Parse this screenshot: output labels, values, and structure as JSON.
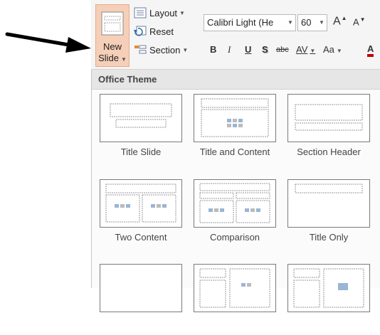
{
  "ribbon": {
    "new_slide_line1": "New",
    "new_slide_line2": "Slide",
    "layout_label": "Layout",
    "reset_label": "Reset",
    "section_label": "Section",
    "font_name": "Calibri Light (He",
    "font_size": "60",
    "grow_font": "A",
    "shrink_font": "A",
    "bold": "B",
    "italic": "I",
    "underline": "U",
    "shadow": "S",
    "strikethrough": "abc",
    "char_spacing": "AV",
    "change_case": "Aa"
  },
  "gallery": {
    "header": "Office Theme",
    "layouts": [
      {
        "label": "Title Slide"
      },
      {
        "label": "Title and Content"
      },
      {
        "label": "Section Header"
      },
      {
        "label": "Two Content"
      },
      {
        "label": "Comparison"
      },
      {
        "label": "Title Only"
      }
    ]
  },
  "colors": {
    "accent": "#f6cfb8",
    "font_color_red": "#c00000"
  }
}
